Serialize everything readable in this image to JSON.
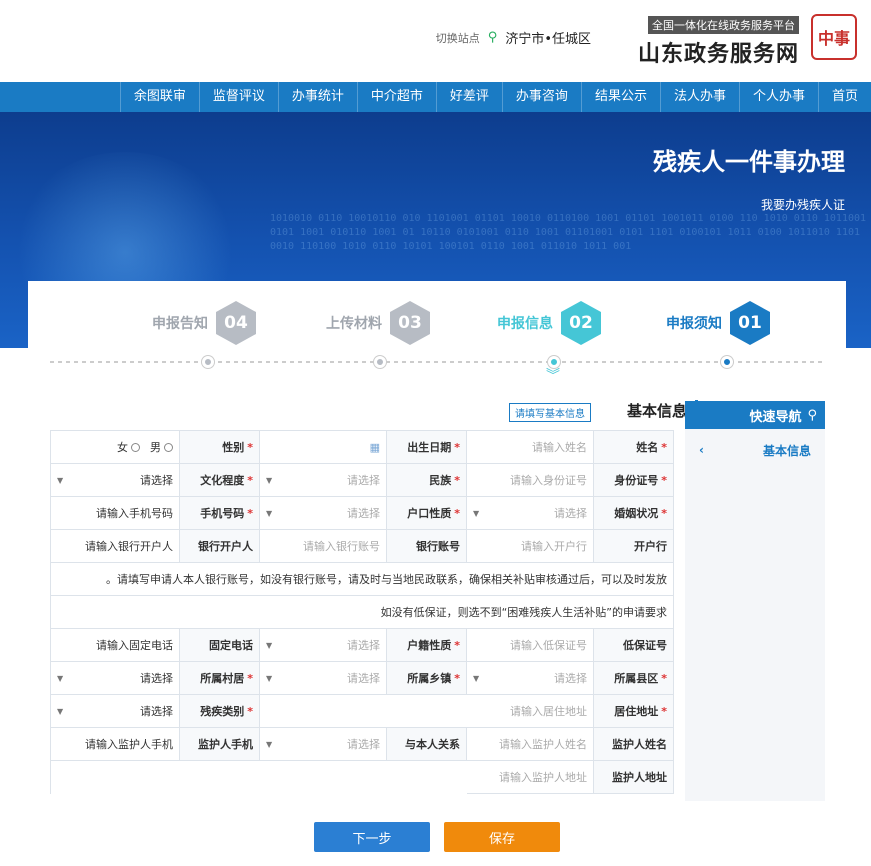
{
  "header": {
    "seal": "中事",
    "logo_sub": "全国一体化在线政务服务平台",
    "logo_main": "山东政务服务网",
    "location": "济宁市•任城区",
    "switch": "切换站点"
  },
  "nav": [
    "首页",
    "个人办事",
    "法人办事",
    "结果公示",
    "办事咨询",
    "好差评",
    "中介超市",
    "办事统计",
    "监督评议",
    "余图联审"
  ],
  "banner": {
    "title": "残疾人一件事办理",
    "subtitle": "我要办残疾人证"
  },
  "steps": [
    {
      "num": "01",
      "label": "申报须知",
      "state": "done",
      "color": "#1a7bc4"
    },
    {
      "num": "02",
      "label": "申报信息",
      "state": "active",
      "color": "#45c6d6"
    },
    {
      "num": "03",
      "label": "上传材料",
      "state": "todo",
      "color": "#b7bcc4"
    },
    {
      "num": "04",
      "label": "申报告知",
      "state": "todo",
      "color": "#b7bcc4"
    }
  ],
  "section": {
    "title": "基本信息",
    "fill_button": "请填写基本信息"
  },
  "form": {
    "name": "姓名",
    "name_ph": "请输入姓名",
    "birth": "出生日期",
    "gender": "性别",
    "male": "男",
    "female": "女",
    "id": "身份证号",
    "id_ph": "请输入身份证号",
    "nation": "民族",
    "select": "请选择",
    "education": "文化程度",
    "marriage": "婚姻状况",
    "hukou": "户口性质",
    "phone": "手机号码",
    "phone_ph": "请输入手机号码",
    "bank": "开户行",
    "bank_ph": "请输入开户行",
    "account": "银行账号",
    "account_ph": "请输入银行账号",
    "holder": "银行开户人",
    "holder_ph": "请输入银行开户人",
    "note1": "请填写申请人本人银行账号，如没有银行账号，请及时与当地民政联系，确保相关补贴审核通过后，可以及时发放。",
    "note2": "如没有低保证，则选不到“困难残疾人生活补贴”的申请要求",
    "dibao": "低保证号",
    "dibao_ph": "请输入低保证号",
    "hukou_loc": "户籍性质",
    "landline": "固定电话",
    "landline_ph": "请输入固定电话",
    "county": "所属县区",
    "town": "所属乡镇",
    "village": "所属村居",
    "address": "居住地址",
    "address_ph": "请输入居住地址",
    "disability": "残疾类别",
    "guardian": "监护人姓名",
    "guardian_ph": "请输入监护人姓名",
    "relation": "与本人关系",
    "guardian_phone": "监护人手机",
    "guardian_phone_ph": "请输入监护人手机",
    "guardian_addr": "监护人地址",
    "guardian_addr_ph": "请输入监护人地址"
  },
  "side": {
    "title": "快速导航",
    "item": "基本信息"
  },
  "buttons": {
    "next": "下一步",
    "save": "保存"
  }
}
